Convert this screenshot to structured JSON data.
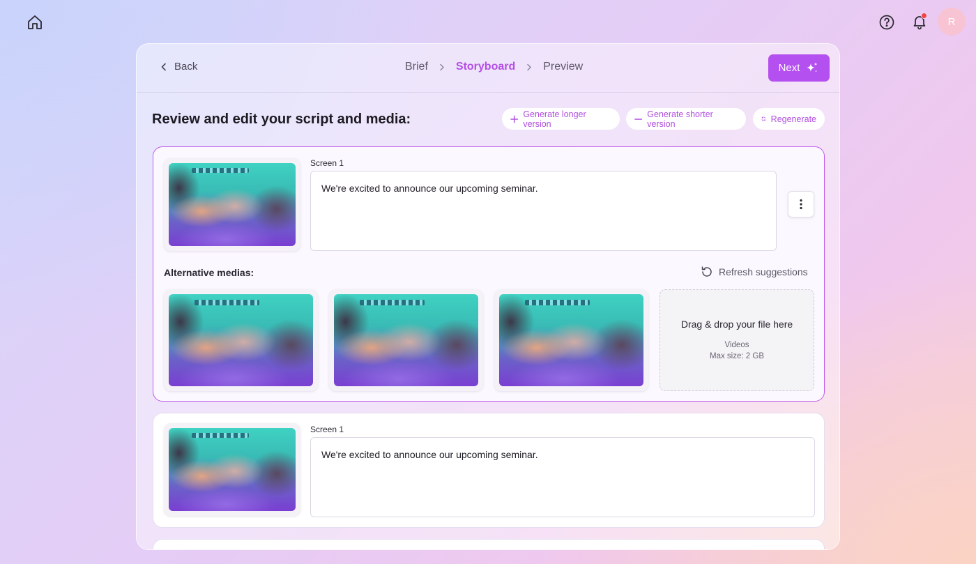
{
  "topbar": {
    "avatar_initial": "R",
    "icons": [
      "home-icon",
      "help-icon",
      "bell-icon"
    ],
    "notification_dot_color": "#ef4444"
  },
  "header": {
    "back_label": "Back",
    "steps": [
      "Brief",
      "Storyboard",
      "Preview"
    ],
    "active_step": "Storyboard",
    "next_label": "Next"
  },
  "editor": {
    "title": "Review and edit your script and media:",
    "actions": {
      "longer": "Generate longer version",
      "shorter": "Generate shorter version",
      "regenerate": "Regenerate"
    }
  },
  "screens": [
    {
      "label": "Screen 1",
      "script": "We're excited to announce our upcoming seminar.",
      "alternative_label": "Alternative medias:",
      "refresh_label": "Refresh suggestions",
      "dropzone": {
        "title": "Drag & drop your file here",
        "type": "Videos",
        "max_size": "Max size: 2 GB"
      }
    },
    {
      "label": "Screen 1",
      "script": "We're excited to announce our upcoming seminar."
    }
  ],
  "colors": {
    "accent": "#b44ff0",
    "accent_text": "#b54ee6"
  }
}
